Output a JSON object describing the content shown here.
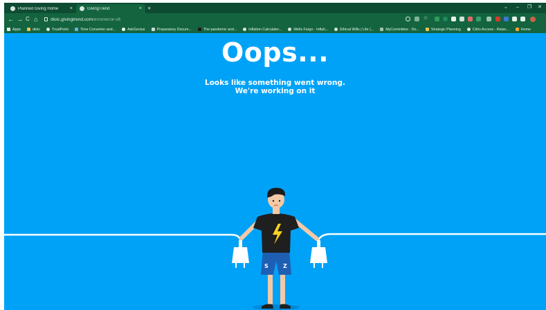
{
  "browser": {
    "tabs": [
      {
        "label": "Planned Giving Home",
        "active": false
      },
      {
        "label": "GivingTrend",
        "active": true
      }
    ],
    "new_tab": "+",
    "tab_close": "×",
    "window_controls": {
      "dropdown": "⌄",
      "minimize": "–",
      "restore": "❐",
      "close": "✕"
    },
    "nav": {
      "back": "←",
      "forward": "→",
      "reload": "C",
      "home": "⌂"
    },
    "url": {
      "host": "dioic.givingtrend.com",
      "path": "/error/error-v6"
    },
    "bookmarks": [
      "Apps",
      "dioic",
      "TrustPoint",
      "Time Converter and...",
      "AskGenius",
      "Preparatory Docum...",
      "The pandemic and...",
      "Inflation Calculator...",
      "Wells Fargo - Inflati...",
      "Ethical Wills | Life (...",
      "MyCommittee - Do...",
      "Strategic Planning",
      "Citrix Access - Raise...",
      "Home"
    ],
    "extension_icons": [
      "search-icon",
      "share-icon",
      "star-icon",
      "leaf-icon",
      "grammarly-icon",
      "bookmark-icon",
      "puzzle-icon",
      "avatar"
    ]
  },
  "page": {
    "headline": "Oops...",
    "subtitle_line1": "Looks like something went wrong.",
    "subtitle_line2": "We're working on it"
  },
  "colors": {
    "page_background": "#00a2f7",
    "browser_frame": "#13643f",
    "tab_strip": "#0d4b33",
    "text": "#ffffff"
  }
}
